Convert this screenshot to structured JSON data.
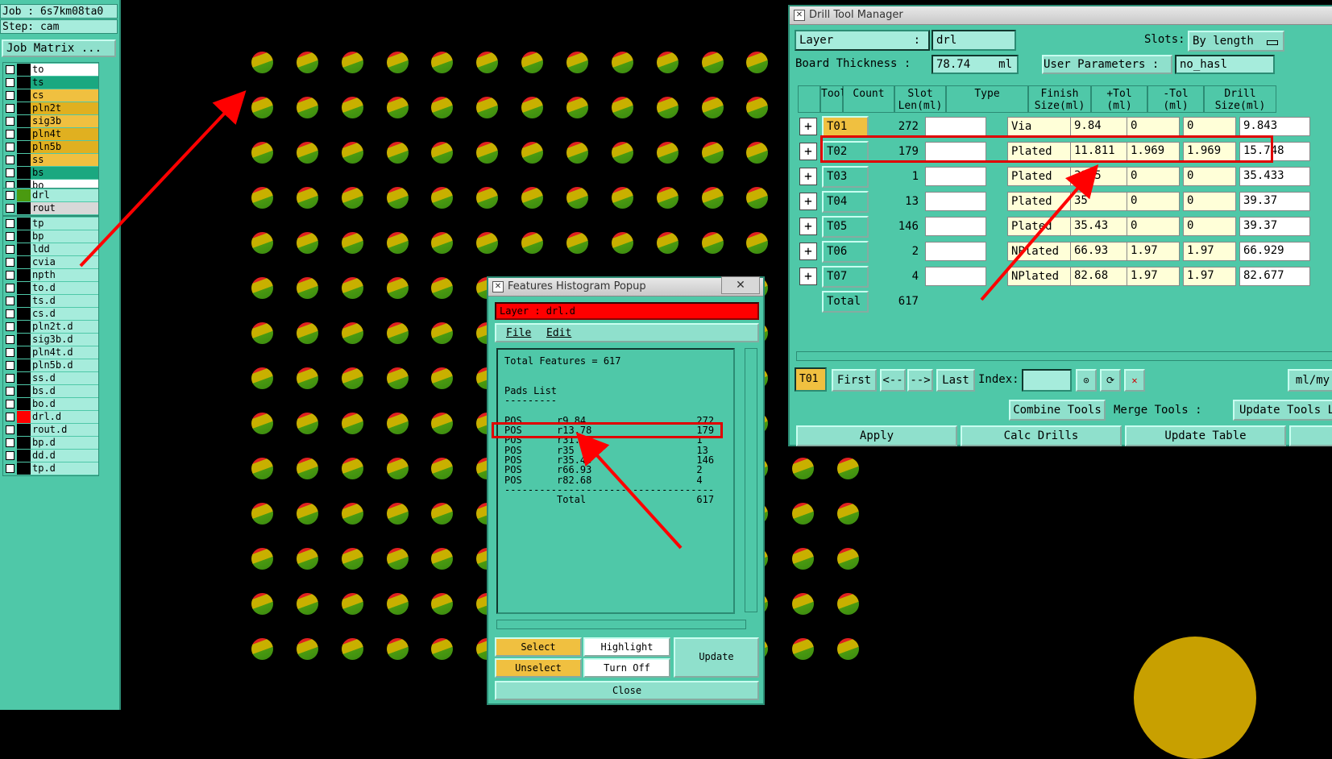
{
  "left_panel": {
    "job": "Job : 6s7km08ta0",
    "step": "Step: cam",
    "job_matrix": "Job Matrix ...",
    "board_layers": [
      {
        "name": "to",
        "color": "#ffffff"
      },
      {
        "name": "ts",
        "color": "#1aa880"
      },
      {
        "name": "cs",
        "color": "#f0c040"
      },
      {
        "name": "pln2t",
        "color": "#e0b020"
      },
      {
        "name": "sig3b",
        "color": "#f0c040"
      },
      {
        "name": "pln4t",
        "color": "#e0b020"
      },
      {
        "name": "pln5b",
        "color": "#e0b020"
      },
      {
        "name": "ss",
        "color": "#f0c040"
      },
      {
        "name": "bs",
        "color": "#1aa880"
      },
      {
        "name": "bo",
        "color": "#ffffff"
      }
    ],
    "drill_layers": [
      {
        "name": "drl",
        "color": "#a6ecdc",
        "swatch": "#4a9a10"
      },
      {
        "name": "rout",
        "color": "#d8d8d8",
        "swatch": "#000000"
      }
    ],
    "misc_layers": [
      "tp",
      "bp",
      "ldd",
      "cvia",
      "npth",
      "to.d",
      "ts.d",
      "cs.d",
      "pln2t.d",
      "sig3b.d",
      "pln4t.d",
      "pln5b.d",
      "ss.d",
      "bs.d",
      "bo.d",
      "drl.d",
      "rout.d",
      "bp.d",
      "dd.d",
      "tp.d"
    ]
  },
  "drill_tool_manager": {
    "title": "Drill Tool Manager",
    "layer_label": "Layer",
    "layer_colon": ":",
    "layer_value": "drl",
    "slots_label": "Slots:",
    "slots_value": "By length",
    "board_thickness_label": "Board Thickness :",
    "board_thickness_value": "78.74",
    "board_thickness_unit": "ml",
    "user_params_label": "User Parameters :",
    "user_params_value": "no_hasl",
    "headers": [
      "Tool",
      "Count",
      "Slot\nLen(ml)",
      "Type",
      "Finish\nSize(ml)",
      "+Tol\n(ml)",
      "-Tol\n(ml)",
      "Drill\nSize(ml)"
    ],
    "rows": [
      {
        "tool": "T01",
        "count": "272",
        "type": "Via",
        "finish": "9.84",
        "ptol": "0",
        "ntol": "0",
        "drill": "9.843"
      },
      {
        "tool": "T02",
        "count": "179",
        "type": "Plated",
        "finish": "11.811",
        "ptol": "1.969",
        "ntol": "1.969",
        "drill": "15.748"
      },
      {
        "tool": "T03",
        "count": "1",
        "type": "Plated",
        "finish": "31.5",
        "ptol": "0",
        "ntol": "0",
        "drill": "35.433"
      },
      {
        "tool": "T04",
        "count": "13",
        "type": "Plated",
        "finish": "35",
        "ptol": "0",
        "ntol": "0",
        "drill": "39.37"
      },
      {
        "tool": "T05",
        "count": "146",
        "type": "Plated",
        "finish": "35.43",
        "ptol": "0",
        "ntol": "0",
        "drill": "39.37"
      },
      {
        "tool": "T06",
        "count": "2",
        "type": "NPlated",
        "finish": "66.93",
        "ptol": "1.97",
        "ntol": "1.97",
        "drill": "66.929"
      },
      {
        "tool": "T07",
        "count": "4",
        "type": "NPlated",
        "finish": "82.68",
        "ptol": "1.97",
        "ntol": "1.97",
        "drill": "82.677"
      }
    ],
    "total_label": "Total",
    "total_value": "617",
    "current_tool": "T01",
    "nav": {
      "first": "First",
      "prev": "<--",
      "next": "-->",
      "last": "Last",
      "index_label": "Index:",
      "units": "ml/my"
    },
    "buttons": {
      "combine": "Combine Tools",
      "merge_label": "Merge Tools :",
      "update_tools": "Update Tools L",
      "apply": "Apply",
      "calc": "Calc Drills",
      "update_table": "Update Table"
    }
  },
  "histogram": {
    "title": "Features Histogram Popup",
    "close_x": "✕",
    "layer_label": "Layer :  drl.d",
    "menu_file": "File",
    "menu_edit": "Edit",
    "lines": [
      "Total Features = 617",
      "",
      "",
      "Pads List",
      "---------",
      "",
      "POS      r9.84                   272",
      "POS      r13.78                  179",
      "POS      r31.5                   1",
      "POS      r35                     13",
      "POS      r35.43                  146",
      "POS      r66.93                  2",
      "POS      r82.68                  4",
      "------------------------------------",
      "         Total                   617"
    ],
    "buttons": {
      "select": "Select",
      "highlight": "Highlight",
      "unselect": "Unselect",
      "turn_off": "Turn Off",
      "update": "Update",
      "close": "Close"
    }
  }
}
